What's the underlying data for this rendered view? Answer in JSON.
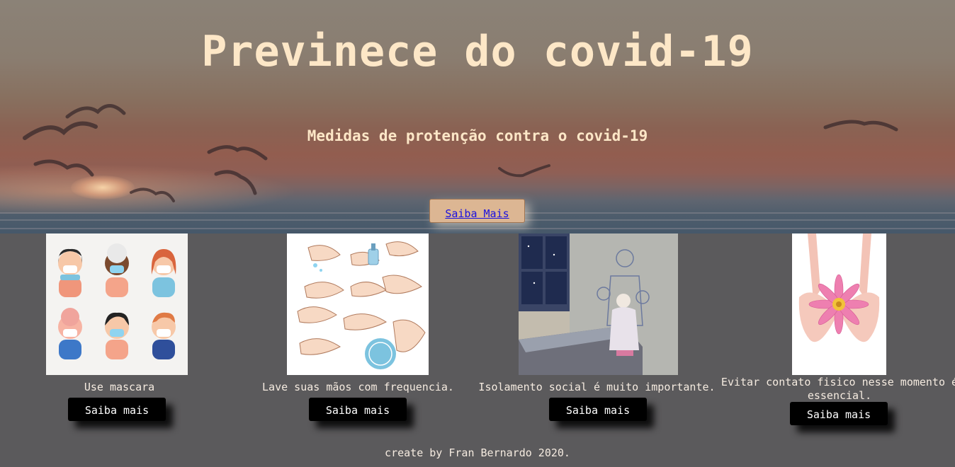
{
  "hero": {
    "title": "Previnece do covid-19",
    "subtitle": "Medidas de protenção contra o covid-19",
    "button_label": "Saiba Mais"
  },
  "cards": [
    {
      "caption": "Use mascara",
      "button_label": "Saiba mais",
      "image": "people-with-masks-illustration"
    },
    {
      "caption": "Lave suas mãos com frequencia.",
      "button_label": "Saiba mais",
      "image": "hand-washing-steps-illustration"
    },
    {
      "caption": "Isolamento social é muito importante.",
      "button_label": "Saiba mais",
      "image": "isolation-room-illustration"
    },
    {
      "caption": "Evitar contato fisico nesse momento é essencial.",
      "button_label": "Saiba mais",
      "image": "hands-holding-pink-flower"
    }
  ],
  "footer": {
    "text": "create by Fran Bernardo 2020."
  },
  "colors": {
    "page_background": "#5b5a5c",
    "hero_text": "#fde7c7",
    "hero_button": "#dcb693",
    "card_button": "#000000"
  }
}
